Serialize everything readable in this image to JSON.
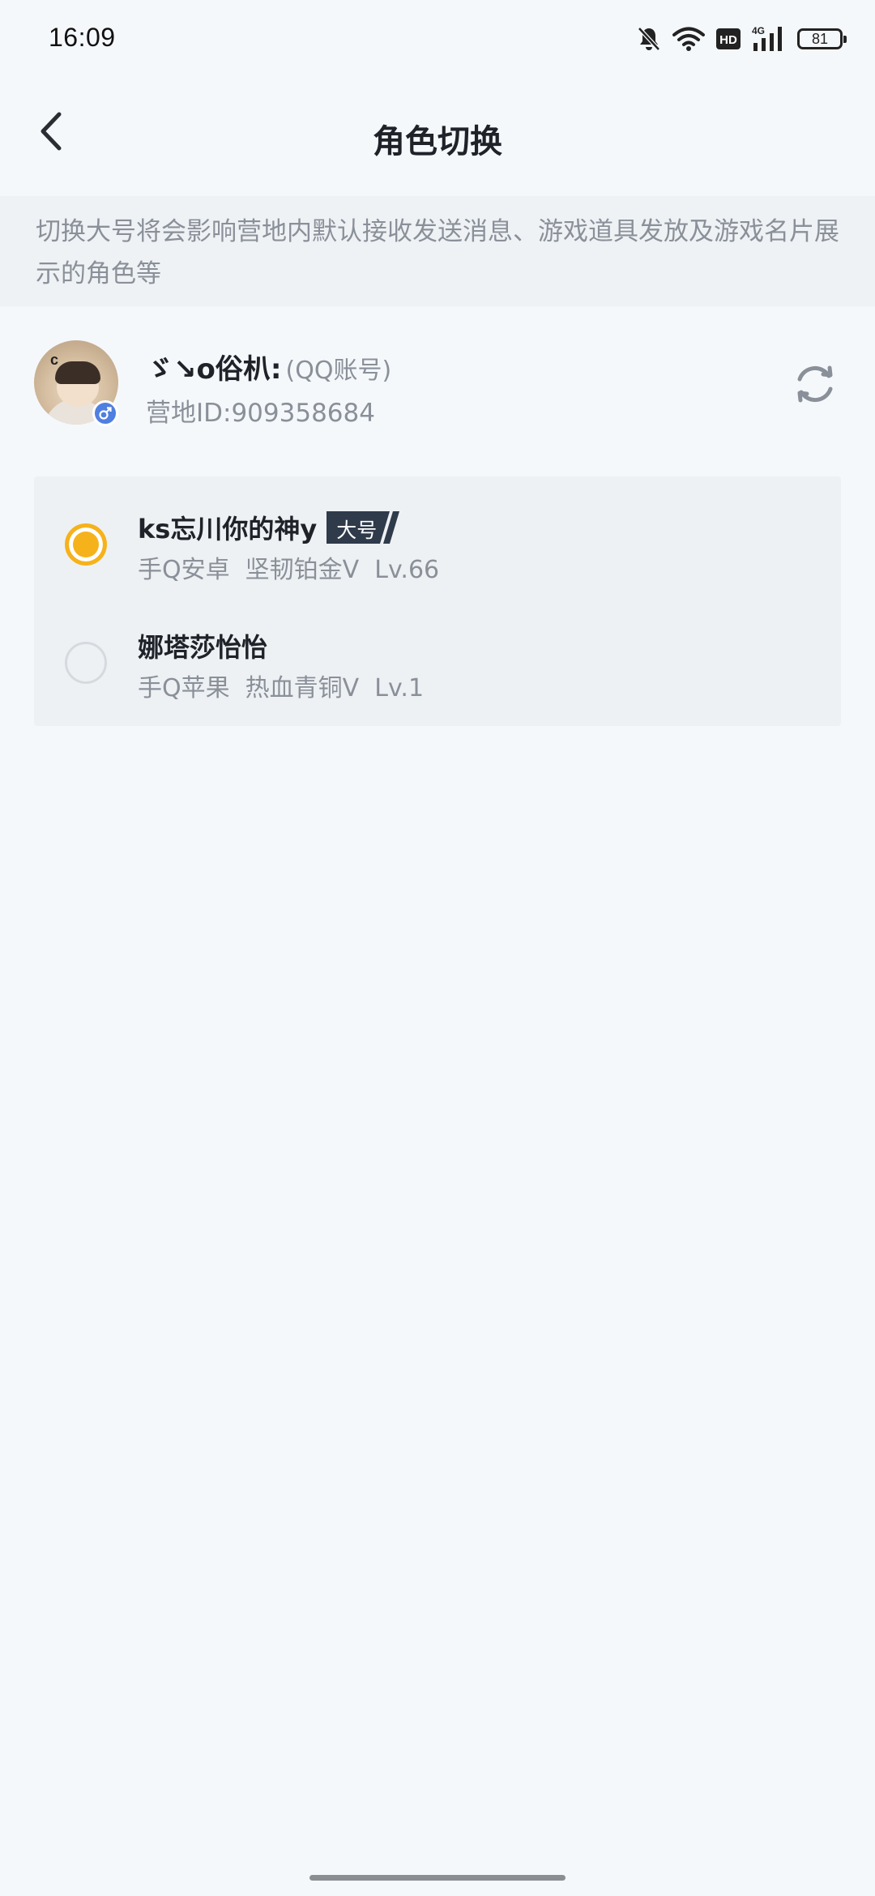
{
  "status_bar": {
    "time": "16:09",
    "battery": "81",
    "icons": [
      "bell-off-icon",
      "wifi-icon",
      "hd-icon",
      "signal-4g-icon",
      "battery-icon"
    ]
  },
  "header": {
    "title": "角色切换",
    "back_icon": "chevron-left-icon"
  },
  "notice": {
    "text": "切换大号将会影响营地内默认接收发送消息、游戏道具发放及游戏名片展示的角色等"
  },
  "account": {
    "name": "ゞ↘o俗朳:",
    "type": "(QQ账号)",
    "id_label": "营地ID:909358684",
    "gender_icon": "male-icon",
    "refresh_icon": "refresh-icon"
  },
  "roles": [
    {
      "name": "ks忘川你的神y",
      "badge": "大号",
      "meta": "手Q安卓  坚韧铂金V  Lv.66",
      "selected": true
    },
    {
      "name": "娜塔莎怡怡",
      "badge": "",
      "meta": "手Q苹果  热血青铜V  Lv.1",
      "selected": false
    }
  ],
  "colors": {
    "accent": "#f6b21b",
    "background": "#f5f8fb",
    "notice_bg": "#eff2f5",
    "secondary_text": "#8a9099"
  }
}
